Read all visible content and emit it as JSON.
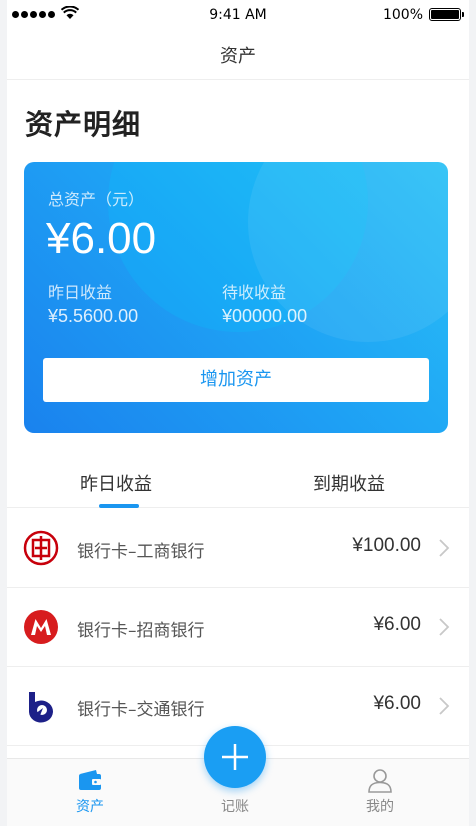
{
  "status_bar": {
    "time": "9:41 AM",
    "battery": "100%"
  },
  "nav": {
    "title": "资产"
  },
  "section_title": "资产明细",
  "summary": {
    "total_label": "总资产（元）",
    "total_amount": "¥6.00",
    "yesterday_label": "昨日收益",
    "yesterday_value": "¥5.5600.00",
    "pending_label": "待收收益",
    "pending_value": "¥00000.00",
    "add_button": "增加资产"
  },
  "tabs": [
    {
      "label": "昨日收益",
      "active": true
    },
    {
      "label": "到期收益",
      "active": false
    }
  ],
  "accounts": [
    {
      "name": "银行卡–工商银行",
      "amount": "¥100.00",
      "icon": "icbc-logo-icon",
      "color": "#c7000b"
    },
    {
      "name": "银行卡–招商银行",
      "amount": "¥6.00",
      "icon": "cmb-logo-icon",
      "color": "#d71c1e"
    },
    {
      "name": "银行卡–交通银行",
      "amount": "¥6.00",
      "icon": "bocom-logo-icon",
      "color": "#1d2088"
    }
  ],
  "tab_bar": {
    "assets": "资产",
    "record": "记账",
    "mine": "我的"
  },
  "colors": {
    "accent": "#1a96f0",
    "card_start": "#2ac1f6",
    "card_end": "#1a82ee"
  }
}
